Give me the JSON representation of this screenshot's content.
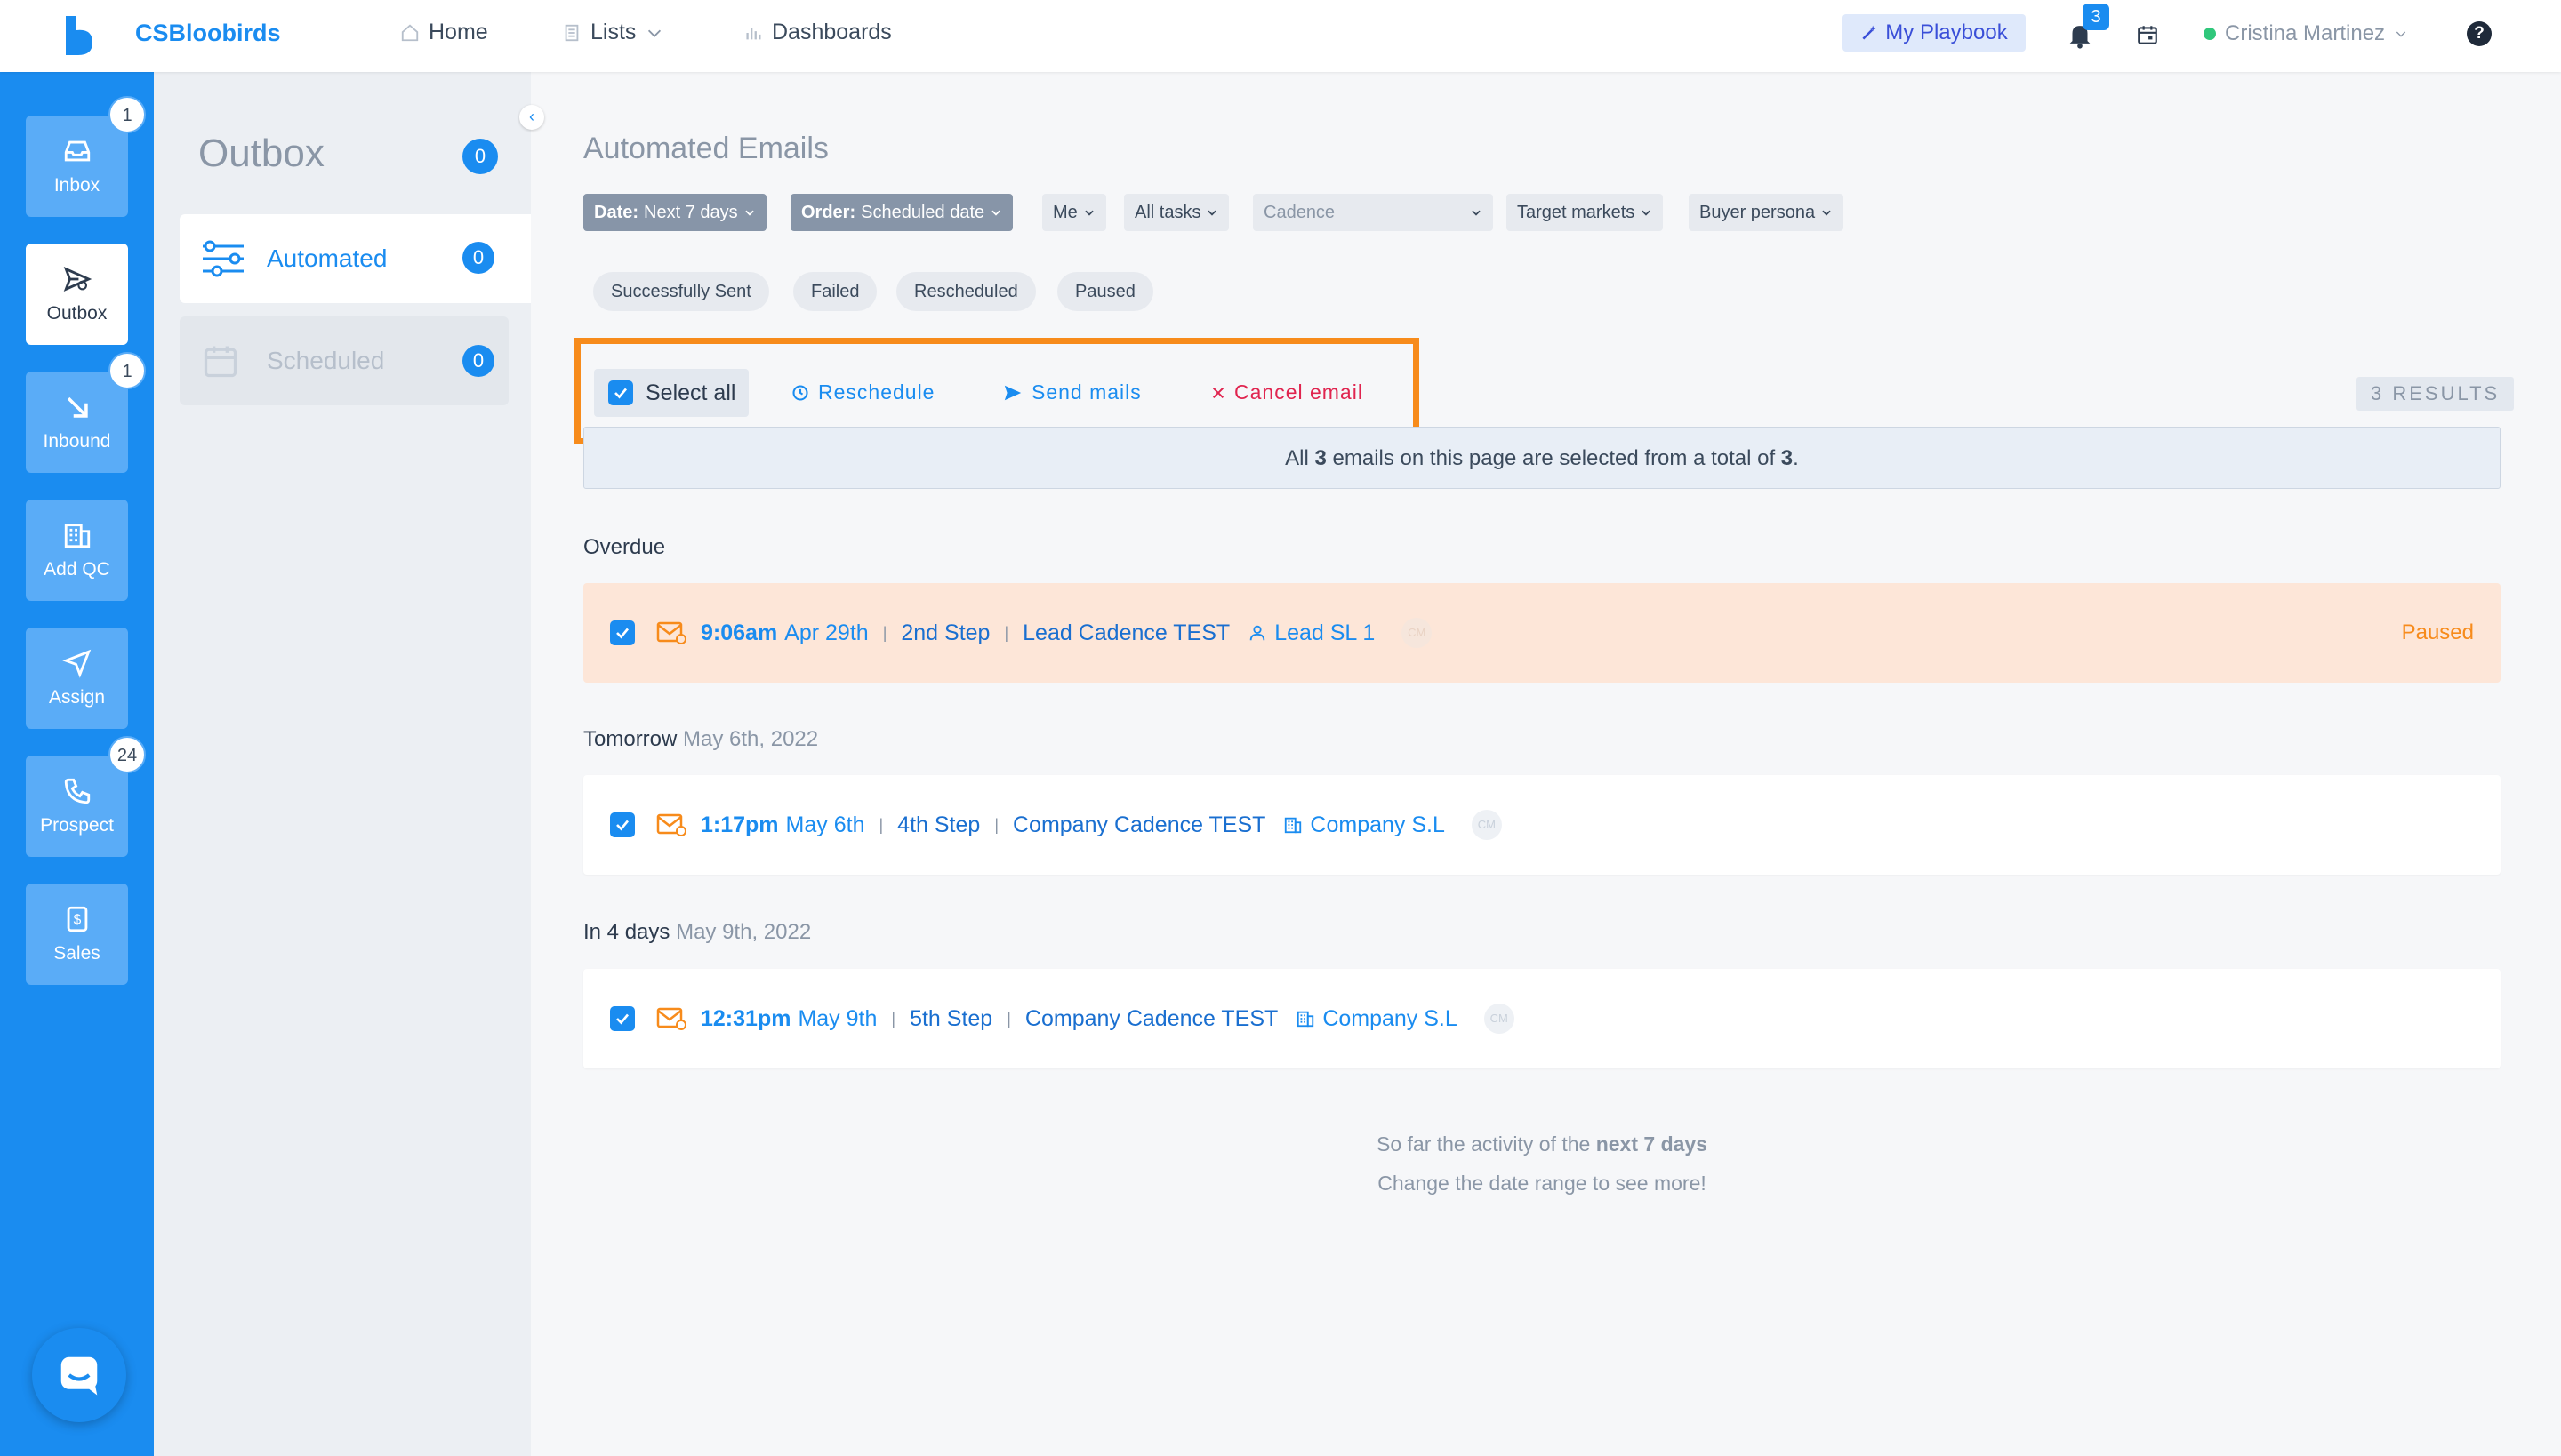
{
  "app": {
    "brand": "CSBloobirds"
  },
  "nav": {
    "home": "Home",
    "lists": "Lists",
    "dashboards": "Dashboards"
  },
  "topbar": {
    "playbook": "My Playbook",
    "notifications": "3",
    "user": "Cristina Martinez",
    "help": "?"
  },
  "rail": {
    "inbox": {
      "label": "Inbox",
      "badge": "1"
    },
    "outbox": {
      "label": "Outbox"
    },
    "inbound": {
      "label": "Inbound",
      "badge": "1"
    },
    "addqc": {
      "label": "Add QC"
    },
    "assign": {
      "label": "Assign"
    },
    "prospect": {
      "label": "Prospect",
      "badge": "24"
    },
    "sales": {
      "label": "Sales"
    }
  },
  "outbox": {
    "title": "Outbox",
    "count": "0",
    "automated": {
      "label": "Automated",
      "count": "0"
    },
    "scheduled": {
      "label": "Scheduled",
      "count": "0"
    }
  },
  "main": {
    "title": "Automated Emails",
    "filters": {
      "date_key": "Date:",
      "date_val": "Next 7 days",
      "order_key": "Order:",
      "order_val": "Scheduled date",
      "me": "Me",
      "tasks": "All tasks",
      "cadence": "Cadence",
      "markets": "Target markets",
      "persona": "Buyer persona"
    },
    "chips": [
      "Successfully Sent",
      "Failed",
      "Rescheduled",
      "Paused"
    ],
    "actions": {
      "select_all": "Select all",
      "reschedule": "Reschedule",
      "send": "Send mails",
      "cancel": "Cancel email"
    },
    "results": "3 RESULTS",
    "selection": {
      "pre": "All ",
      "n": "3",
      "mid": " emails on this page are selected from a total of ",
      "total": "3",
      "post": "."
    },
    "sections": {
      "overdue": {
        "label": "Overdue"
      },
      "tomorrow": {
        "label": "Tomorrow",
        "date": "May 6th, 2022"
      },
      "in4": {
        "label": "In 4 days",
        "date": "May 9th, 2022"
      }
    },
    "rows": [
      {
        "time": "9:06am",
        "date": "Apr 29th",
        "step": "2nd Step",
        "cadence": "Lead Cadence TEST",
        "entity": "Lead SL 1",
        "avatar": "CM",
        "status": "Paused"
      },
      {
        "time": "1:17pm",
        "date": "May 6th",
        "step": "4th Step",
        "cadence": "Company Cadence TEST",
        "entity": "Company S.L",
        "avatar": "CM"
      },
      {
        "time": "12:31pm",
        "date": "May 9th",
        "step": "5th Step",
        "cadence": "Company Cadence TEST",
        "entity": "Company S.L",
        "avatar": "CM"
      }
    ],
    "footer": {
      "line1_pre": "So far the activity of the ",
      "line1_bold": "next 7 days",
      "line2": "Change the date range to see more!"
    }
  },
  "colors": {
    "primary": "#1a8cf0",
    "highlight": "#f78b1b",
    "overdue_bg": "#fde6d8",
    "cancel": "#e0244f"
  },
  "icons": [
    "logo-icon",
    "home-icon",
    "list-icon",
    "chart-icon",
    "wand-icon",
    "bell-icon",
    "calendar-icon",
    "chevron-down-icon",
    "inbox-icon",
    "send-icon",
    "arrow-down-right-icon",
    "building-icon",
    "navigation-icon",
    "phone-icon",
    "dollar-icon",
    "chat-icon",
    "automation-icon",
    "clock-icon",
    "close-icon",
    "check-icon",
    "mail-icon",
    "user-icon"
  ]
}
